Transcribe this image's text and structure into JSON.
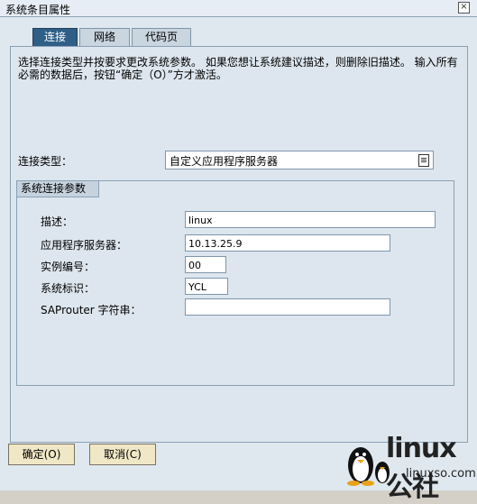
{
  "window": {
    "title": "系统条目属性",
    "close_glyph": "×"
  },
  "tabs": [
    {
      "label": "连接",
      "active": true
    },
    {
      "label": "网络",
      "active": false
    },
    {
      "label": "代码页",
      "active": false
    }
  ],
  "info_text": "选择连接类型并按要求更改系统参数。 如果您想让系统建议描述，则删除旧描述。 输入所有必需的数据后，按钮“确定（O）”方才激活。",
  "connection": {
    "label": "连接类型：",
    "value": "自定义应用程序服务器"
  },
  "group": {
    "title": "系统连接参数",
    "fields": [
      {
        "label": "描述：",
        "value": "linux"
      },
      {
        "label": "应用程序服务器：",
        "value": "10.13.25.9"
      },
      {
        "label": "实例编号：",
        "value": "00"
      },
      {
        "label": "系统标识：",
        "value": "YCL"
      },
      {
        "label": "SAProuter 字符串：",
        "value": ""
      }
    ]
  },
  "buttons": {
    "ok": "确定(O)",
    "cancel": "取消(C)"
  },
  "watermark": {
    "brand": "linux公社",
    "url": "linuxso.com"
  }
}
